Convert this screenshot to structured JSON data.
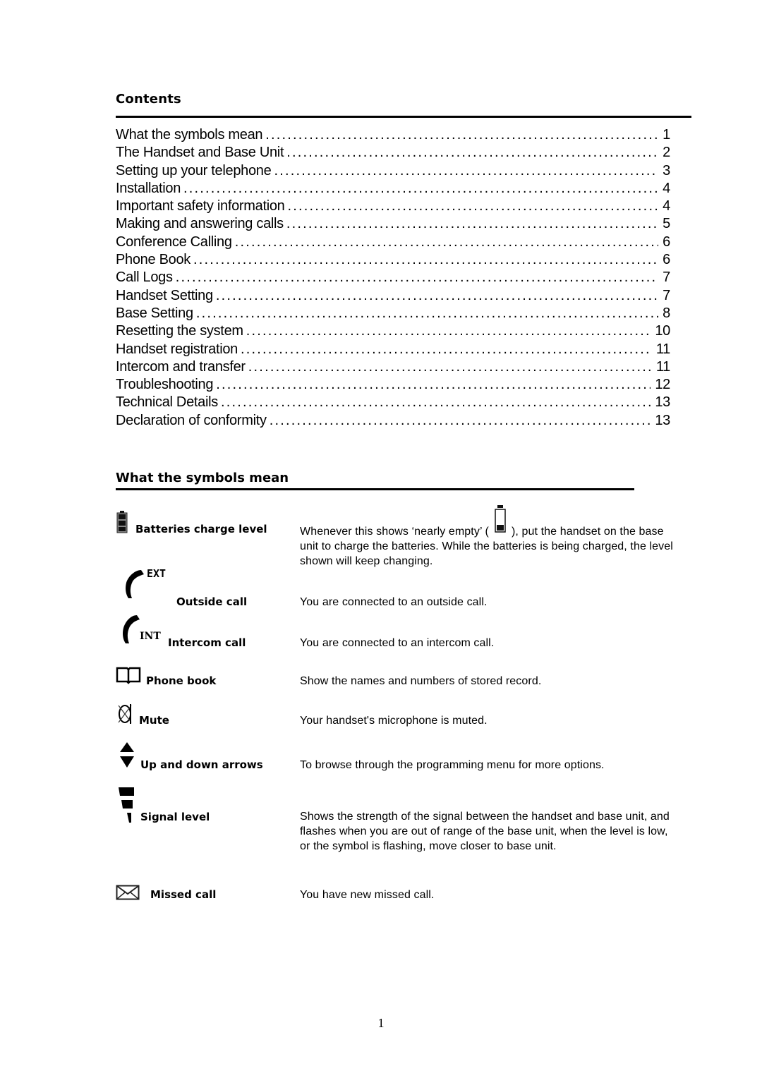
{
  "contents": {
    "heading": "Contents",
    "entries": [
      {
        "title": "What the symbols mean",
        "page": "1"
      },
      {
        "title": "The Handset and Base Unit",
        "page": "2"
      },
      {
        "title": "Setting up your telephone",
        "page": "3"
      },
      {
        "title": "Installation",
        "page": "4"
      },
      {
        "title": "Important safety information",
        "page": "4"
      },
      {
        "title": "Making and answering calls",
        "page": "5"
      },
      {
        "title": "Conference Calling",
        "page": "6"
      },
      {
        "title": "Phone Book",
        "page": "6"
      },
      {
        "title": "Call Logs",
        "page": "7"
      },
      {
        "title": "Handset Setting",
        "page": "7"
      },
      {
        "title": "Base Setting",
        "page": "8"
      },
      {
        "title": "Resetting the system",
        "page": "10"
      },
      {
        "title": "Handset registration",
        "page": "11"
      },
      {
        "title": "Intercom and transfer",
        "page": "11"
      },
      {
        "title": "Troubleshooting",
        "page": "12"
      },
      {
        "title": "Technical Details",
        "page": "13"
      },
      {
        "title": "Declaration of conformity",
        "page": "13"
      }
    ]
  },
  "symbols": {
    "heading": "What the symbols mean",
    "items": [
      {
        "icon": "battery-icon",
        "label": "Batteries charge level",
        "description_before": "Whenever this shows ‘nearly empty’ (",
        "description_icon": "battery-empty-icon",
        "description_after": "), put the handset on the base unit to charge the batteries. While the batteries is being charged, the level shown will keep changing."
      },
      {
        "icon": "outside-call-icon",
        "icon_text": "EXT",
        "label": "Outside call",
        "description": "You are connected to an outside call."
      },
      {
        "icon": "intercom-call-icon",
        "icon_text": "INT",
        "label": "Intercom call",
        "description": "You are connected to an intercom call."
      },
      {
        "icon": "phone-book-icon",
        "label": "Phone book",
        "description": "Show the names and numbers of stored record."
      },
      {
        "icon": "mute-icon",
        "label": "Mute",
        "description": "Your handset's microphone is muted."
      },
      {
        "icon": "up-down-arrows-icon",
        "label": "Up and down arrows",
        "description": "To browse through the programming menu for more options."
      },
      {
        "icon": "signal-level-icon",
        "label": "Signal level",
        "description": "Shows the strength of the signal between the handset and base unit, and flashes when you are out of range of the base unit, when the level is low, or the symbol is flashing, move closer to base unit."
      },
      {
        "icon": "missed-call-icon",
        "label": "Missed call",
        "description": "You have new missed call."
      }
    ]
  },
  "footer": {
    "page_number": "1"
  }
}
